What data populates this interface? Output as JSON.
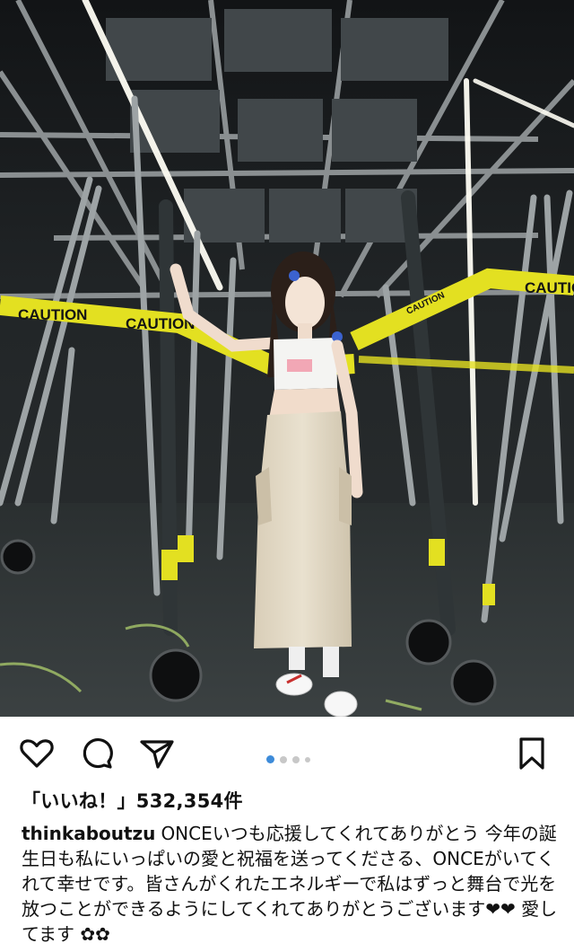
{
  "post": {
    "image_alt": "Woman in white crop top and long beige cargo skirt posing among stage scaffolding with caution tape",
    "tape_texts": [
      "CAUTION",
      "CAUTION",
      "CAUTION",
      "CAUTION"
    ],
    "carousel": {
      "count": 4,
      "active": 0
    },
    "likes_label": "「いいね！」532,354件",
    "caption_user": "thinkaboutzu",
    "caption_text": "ONCEいつも応援してくれてありがとう 今年の誕生日も私にいっぱいの愛と祝福を送ってくださる、ONCEがいてくれて幸せです。皆さんがくれたエネルギーで私はずっと舞台で光を放つことができるようにしてくれてありがとうございます❤❤ 愛してます ✿✿"
  },
  "actions": {
    "like": "heart-icon",
    "comment": "comment-icon",
    "share": "send-icon",
    "save": "bookmark-icon"
  },
  "colors": {
    "tape": "#e3e021",
    "carousel_active": "#3d8bd9",
    "carousel_inactive": "#c8c8c8"
  }
}
